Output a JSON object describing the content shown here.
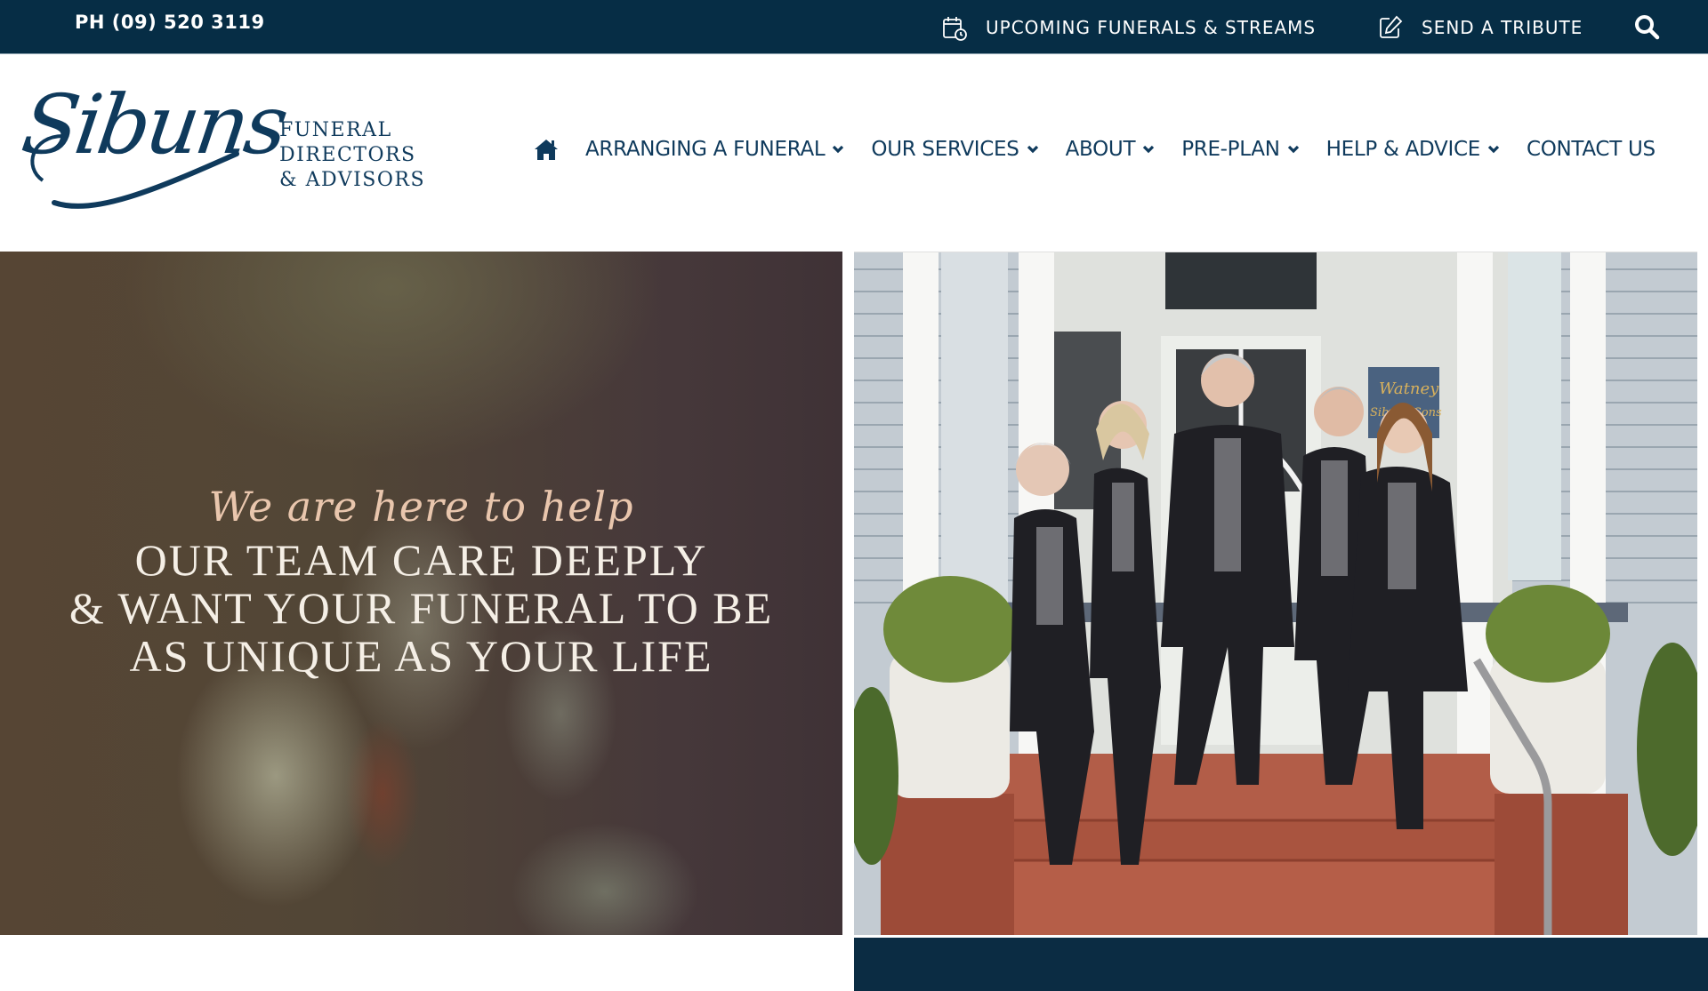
{
  "topbar": {
    "phone": "PH (09) 520 3119",
    "links": [
      {
        "label": "UPCOMING FUNERALS & STREAMS",
        "icon": "calendar-clock-icon"
      },
      {
        "label": "SEND A TRIBUTE",
        "icon": "edit-icon"
      }
    ],
    "search_icon": "search-icon"
  },
  "header": {
    "logo_script": "Sibuns",
    "logo_tagline": [
      "FUNERAL",
      "DIRECTORS",
      "& ADVISORS"
    ],
    "nav": {
      "home_icon": "home-icon",
      "items": [
        {
          "label": "ARRANGING A FUNERAL",
          "has_dropdown": true
        },
        {
          "label": "OUR SERVICES",
          "has_dropdown": true
        },
        {
          "label": "ABOUT",
          "has_dropdown": true
        },
        {
          "label": "PRE-PLAN",
          "has_dropdown": true
        },
        {
          "label": "HELP & ADVICE",
          "has_dropdown": true
        },
        {
          "label": "CONTACT US",
          "has_dropdown": false
        }
      ]
    }
  },
  "hero": {
    "script_line": "We are here to help",
    "heading_lines": [
      "OUR TEAM CARE DEEPLY",
      "& WANT YOUR FUNERAL TO BE",
      "AS UNIQUE AS YOUR LIFE"
    ],
    "photo_alt": "Sibuns team of five funeral directors standing on the front steps of the funeral home",
    "sign_text": [
      "Watney",
      "Sibuns Sons"
    ]
  },
  "colors": {
    "brand_navy": "#062d45",
    "logo_blue": "#0f3a5c",
    "script_peach": "#e9c6ad",
    "bottom_block": "#0b2c43"
  }
}
